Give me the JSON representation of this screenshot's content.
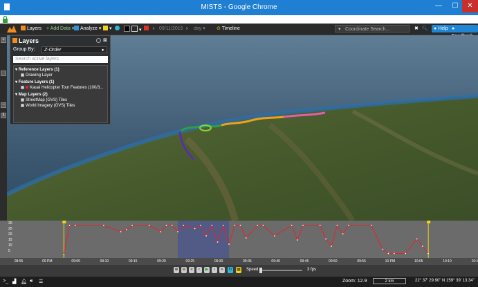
{
  "window": {
    "title": "MISTS - Google Chrome"
  },
  "toolbar": {
    "layers_label": "Layers",
    "add_data_label": "+ Add Data",
    "analyze_label": "Analyze",
    "date_value": "09/11/2015",
    "period_value": "day",
    "timeline_label": "Timeline",
    "coord_search_placeholder": "Coordinate Search...",
    "help_label": "Help",
    "feedback_label": "Feedback"
  },
  "layers_panel": {
    "title": "Layers",
    "group_by_label": "Group By:",
    "group_by_value": "Z-Order",
    "search_placeholder": "Search active layers",
    "tree": [
      {
        "label": "Reference Layers (1)",
        "group": true
      },
      {
        "label": "Drawing Layer",
        "group": false
      },
      {
        "label": "Feature Layers (1)",
        "group": true
      },
      {
        "label": "Kauai Helicopter Tour Features (100/3...",
        "group": false
      },
      {
        "label": "Map Layers (2)",
        "group": true
      },
      {
        "label": "StreetMap (GVS) Tiles",
        "group": false
      },
      {
        "label": "World Imagery (GVS) Tiles",
        "group": false
      }
    ]
  },
  "timeline": {
    "y_ticks": [
      "30",
      "25",
      "20",
      "15",
      "10",
      "5"
    ],
    "time_ticks": [
      "08:55",
      "09 PM",
      "09:05",
      "09:10",
      "09:15",
      "09:20",
      "09:25",
      "09:30",
      "09:35",
      "09:40",
      "09:45",
      "09:50",
      "09:55",
      "10 PM",
      "10:05",
      "10:10",
      "10:15"
    ]
  },
  "chart_data": {
    "type": "area",
    "title": "",
    "xlabel": "",
    "ylabel": "",
    "ylim": [
      0,
      30
    ],
    "x_range": [
      "08:53",
      "10:15"
    ],
    "selected_window": [
      "09:23",
      "09:32"
    ],
    "x": [
      "09:03",
      "09:04",
      "09:05",
      "09:10",
      "09:13",
      "09:14",
      "09:15",
      "09:18",
      "09:20",
      "09:21",
      "09:22",
      "09:23",
      "09:24",
      "09:26",
      "09:27",
      "09:28",
      "09:29",
      "09:30",
      "09:31",
      "09:32",
      "09:33",
      "09:34",
      "09:35",
      "09:37",
      "09:38",
      "09:40",
      "09:43",
      "09:44",
      "09:45",
      "09:48",
      "09:49",
      "09:50",
      "09:51",
      "09:52",
      "09:53",
      "09:57",
      "09:59",
      "10:00",
      "10:01",
      "10:03",
      "10:05",
      "10:06",
      "10:07"
    ],
    "y": [
      0,
      28,
      28,
      28,
      22,
      24,
      28,
      28,
      22,
      28,
      28,
      22,
      28,
      25,
      28,
      18,
      28,
      12,
      28,
      10,
      28,
      28,
      16,
      28,
      28,
      18,
      28,
      14,
      28,
      28,
      15,
      8,
      28,
      20,
      28,
      28,
      5,
      1,
      1,
      1,
      15,
      8,
      1
    ]
  },
  "controls": {
    "speed_label": "Speed",
    "fps_label": "3 fps"
  },
  "status": {
    "zoom_label": "Zoom: 12.9",
    "scale_label": "2 km",
    "coordinates": "22° 37' 29.90\" N 159° 39' 13.34\""
  },
  "colors": {
    "title_bar": "#1e7fd3",
    "accent_blue": "#1f86d6",
    "timeline_line": "#e8212a",
    "timeline_bg": "#6b6b6b",
    "selection": "#3c4f9a",
    "marker_yellow": "#f2d21b"
  }
}
